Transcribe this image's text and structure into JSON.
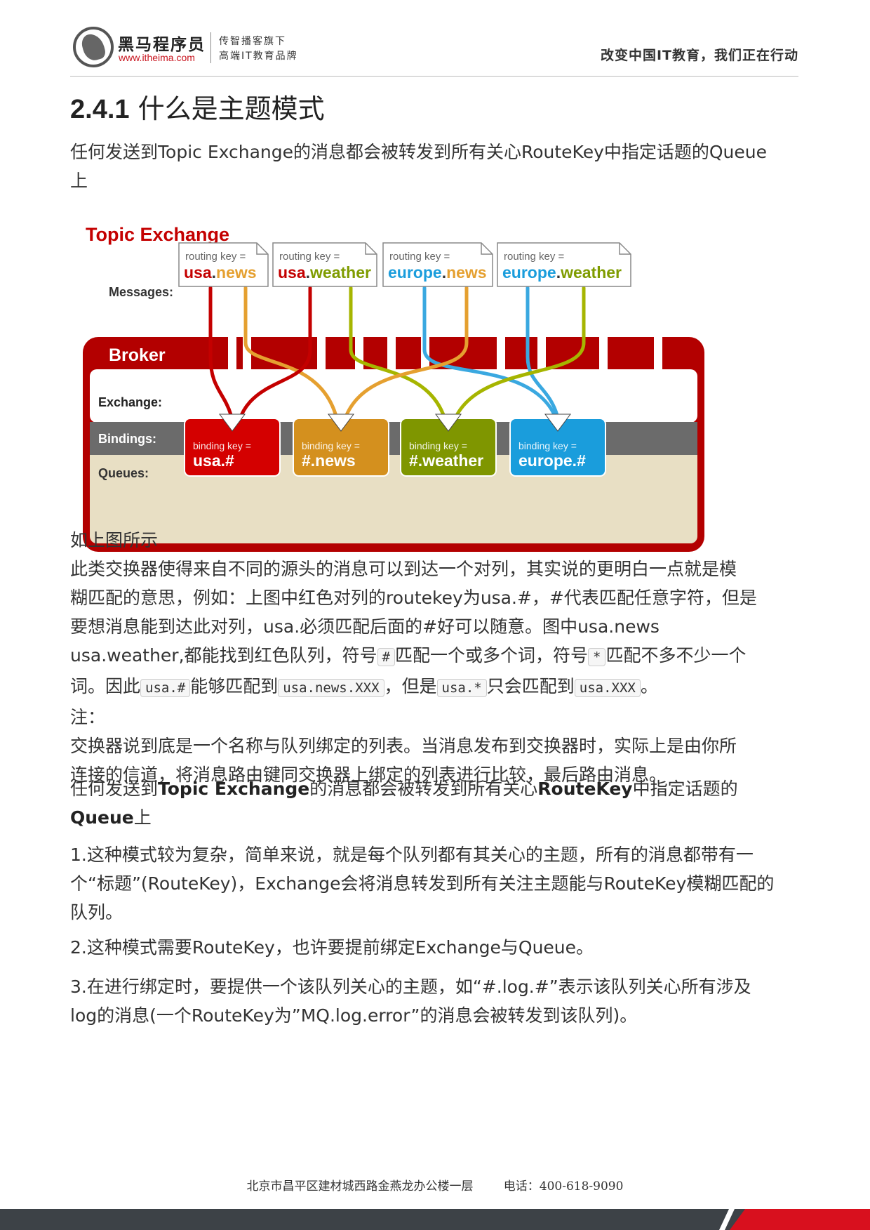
{
  "header": {
    "brand_name": "黑马程序员",
    "brand_url": "www.itheima.com",
    "tagline_line1": "传智播客旗下",
    "tagline_line2": "高端IT教育品牌",
    "slogan": "改变中国IT教育，我们正在行动"
  },
  "section": {
    "number": "2.4.1",
    "title": "什么是主题模式"
  },
  "intro": {
    "line1": "任何发送到Topic Exchange的消息都会被转发到所有关心RouteKey中指定话题的Queue",
    "line2": "上"
  },
  "diagram": {
    "title": "Topic Exchange",
    "messages_label": "Messages:",
    "broker_label": "Broker",
    "exchange_label": "Exchange:",
    "bindings_label": "Bindings:",
    "queues_label": "Queues:",
    "routing_key_prefix": "routing key =",
    "binding_key_prefix": "binding key =",
    "messages": [
      {
        "part1": "usa",
        "sep": ".",
        "part2": "news"
      },
      {
        "part1": "usa",
        "sep": ".",
        "part2": "weather"
      },
      {
        "part1": "europe",
        "sep": ".",
        "part2": "news"
      },
      {
        "part1": "europe",
        "sep": ".",
        "part2": "weather"
      }
    ],
    "queues": [
      {
        "key": "usa.#",
        "color": "#d40000"
      },
      {
        "key": "#.news",
        "color": "#d4901e"
      },
      {
        "key": "#.weather",
        "color": "#7f9600"
      },
      {
        "key": "europe.#",
        "color": "#1a9ddc"
      }
    ],
    "colors": {
      "usa": "#c40000",
      "europe": "#1a9ddc",
      "news": "#e5a030",
      "weather": "#7f9c00",
      "broker": "#b30000"
    }
  },
  "body": {
    "caption": "如上图所示",
    "explain_l1": "此类交换器使得来自不同的源头的消息可以到达一个对列，其实说的更明白一点就是模",
    "explain_l2": "糊匹配的意思，例如：上图中红色对列的routekey为usa.#，#代表匹配任意字符，但是",
    "explain_l3": "要想消息能到达此对列，usa.必须匹配后面的#好可以随意。图中usa.news",
    "explain_l4a": "usa.weather,都能找到红色队列，符号",
    "code_hash": "#",
    "explain_l4b": "匹配一个或多个词，符号",
    "code_star": "*",
    "explain_l4c": "匹配不多不少一个",
    "explain_l5a": "词。因此",
    "code_usa_hash": "usa.#",
    "explain_l5b": "能够匹配到",
    "code_usa_news_xxx": "usa.news.XXX",
    "explain_l5c": "，但是",
    "code_usa_star": "usa.*",
    "explain_l5d": "只会匹配到",
    "code_usa_xxx": "usa.XXX",
    "explain_l5e": "。",
    "note_label": "注：",
    "note_l1": "交换器说到底是一个名称与队列绑定的列表。当消息发布到交换器时，实际上是由你所",
    "note_l2": "连接的信道，将消息路由键同交换器上绑定的列表进行比较，最后路由消息。",
    "bold_p_a": "任何发送到",
    "bold_p_b": "Topic Exchange",
    "bold_p_c": "的消息都会被转发到所有关心",
    "bold_p_d": "RouteKey",
    "bold_p_e": "中指定话题的",
    "bold_p_f": "Queue",
    "bold_p_g": "上",
    "point1_l1": "1.这种模式较为复杂，简单来说，就是每个队列都有其关心的主题，所有的消息都带有一",
    "point1_l2": "个“标题”(RouteKey)，Exchange会将消息转发到所有关注主题能与RouteKey模糊匹配的",
    "point1_l3": "队列。",
    "point2": "2.这种模式需要RouteKey，也许要提前绑定Exchange与Queue。",
    "point3_l1": "3.在进行绑定时，要提供一个该队列关心的主题，如“#.log.#”表示该队列关心所有涉及",
    "point3_l2": "log的消息(一个RouteKey为”MQ.log.error”的消息会被转发到该队列)。"
  },
  "footer": {
    "address": "北京市昌平区建材城西路金燕龙办公楼一层",
    "phone": "电话：400-618-9090"
  }
}
